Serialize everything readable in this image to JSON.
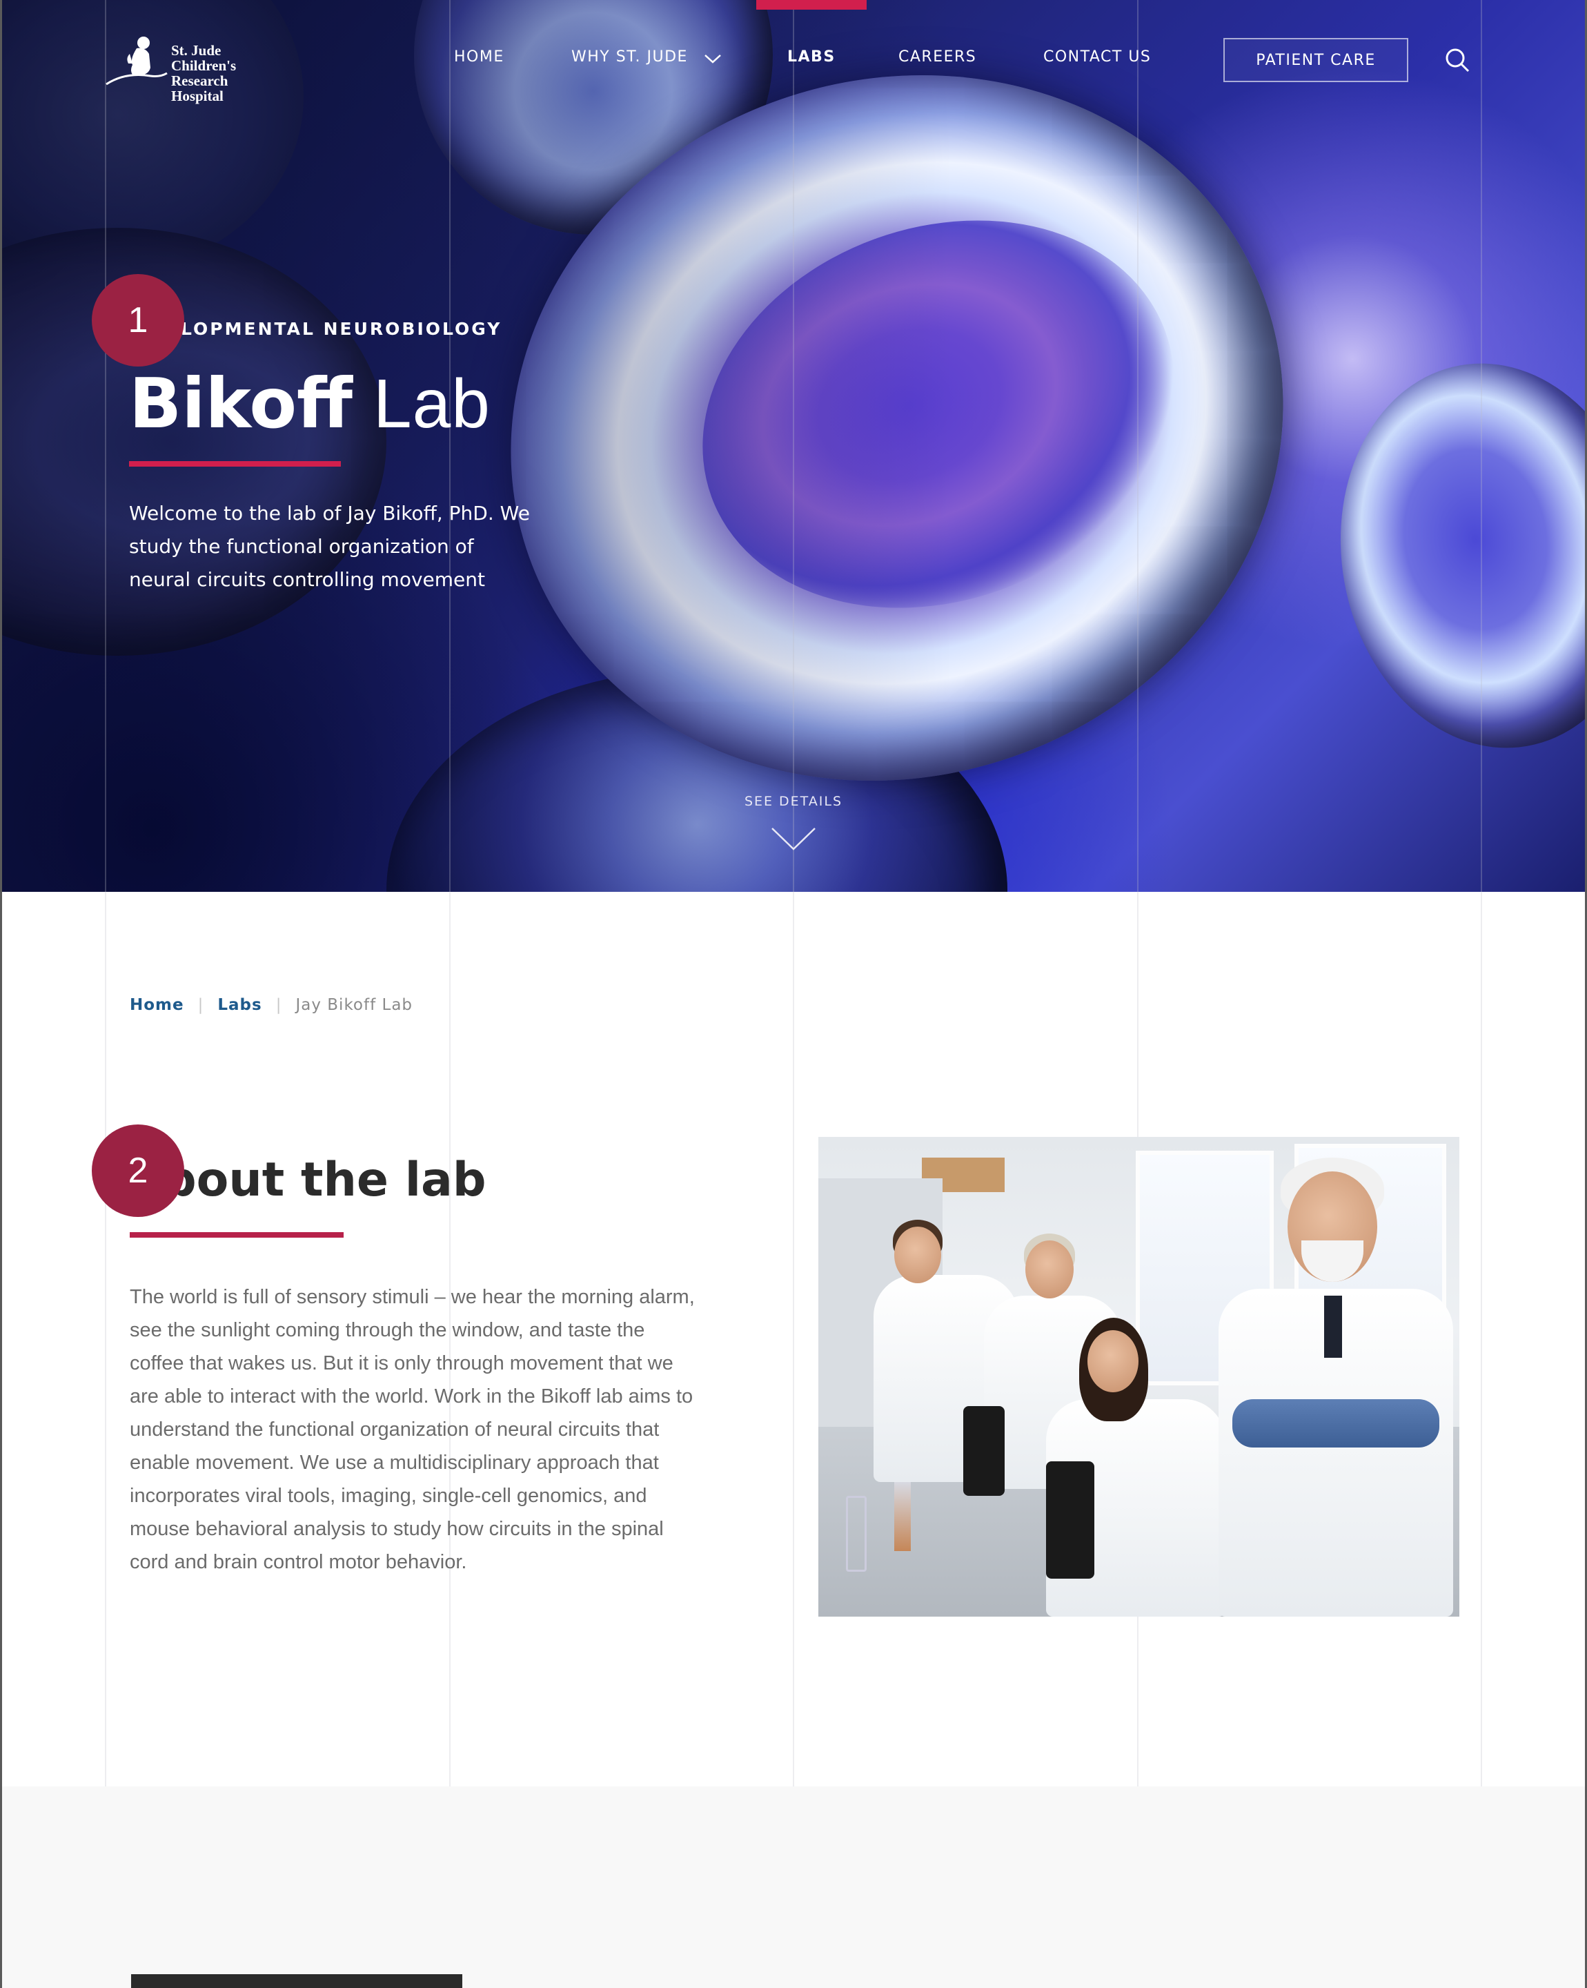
{
  "logo": {
    "line1": "St. Jude Children's",
    "line2": "Research Hospital"
  },
  "nav": {
    "items": [
      {
        "label": "HOME"
      },
      {
        "label": "WHY ST. JUDE"
      },
      {
        "label": "LABS"
      },
      {
        "label": "CAREERS"
      },
      {
        "label": "CONTACT US"
      }
    ],
    "active": "LABS",
    "cta_label": "PATIENT CARE",
    "icons": [
      "chevron-down-icon",
      "search-icon"
    ]
  },
  "hero": {
    "eyebrow": "LOPMENTAL NEUROBIOLOGY",
    "title_strong": "Bikoff",
    "title_light": "Lab",
    "description": "Welcome to the lab of Jay Bikoff, PhD. We study the functional organization of neural circuits controlling movement",
    "see_details": "SEE DETAILS"
  },
  "steps": [
    "1",
    "2"
  ],
  "breadcrumb": {
    "items": [
      "Home",
      "Labs"
    ],
    "current": "Jay Bikoff Lab"
  },
  "about": {
    "title": "bout the lab",
    "body": "The world is full of sensory stimuli – we hear the morning alarm, see the sunlight coming through the window, and taste the coffee that wakes us. But it is only through movement that we are able to interact with the world. Work in the Bikoff lab aims to understand the functional organization of neural circuits that enable movement. We use a multidisciplinary approach that incorporates viral tools, imaging, single-cell genomics, and mouse behavioral analysis to study how circuits in the spinal cord and brain control motor behavior."
  },
  "colors": {
    "accent": "#d11f4d",
    "step_marker": "#9b2243",
    "link": "#1e5a8c"
  }
}
